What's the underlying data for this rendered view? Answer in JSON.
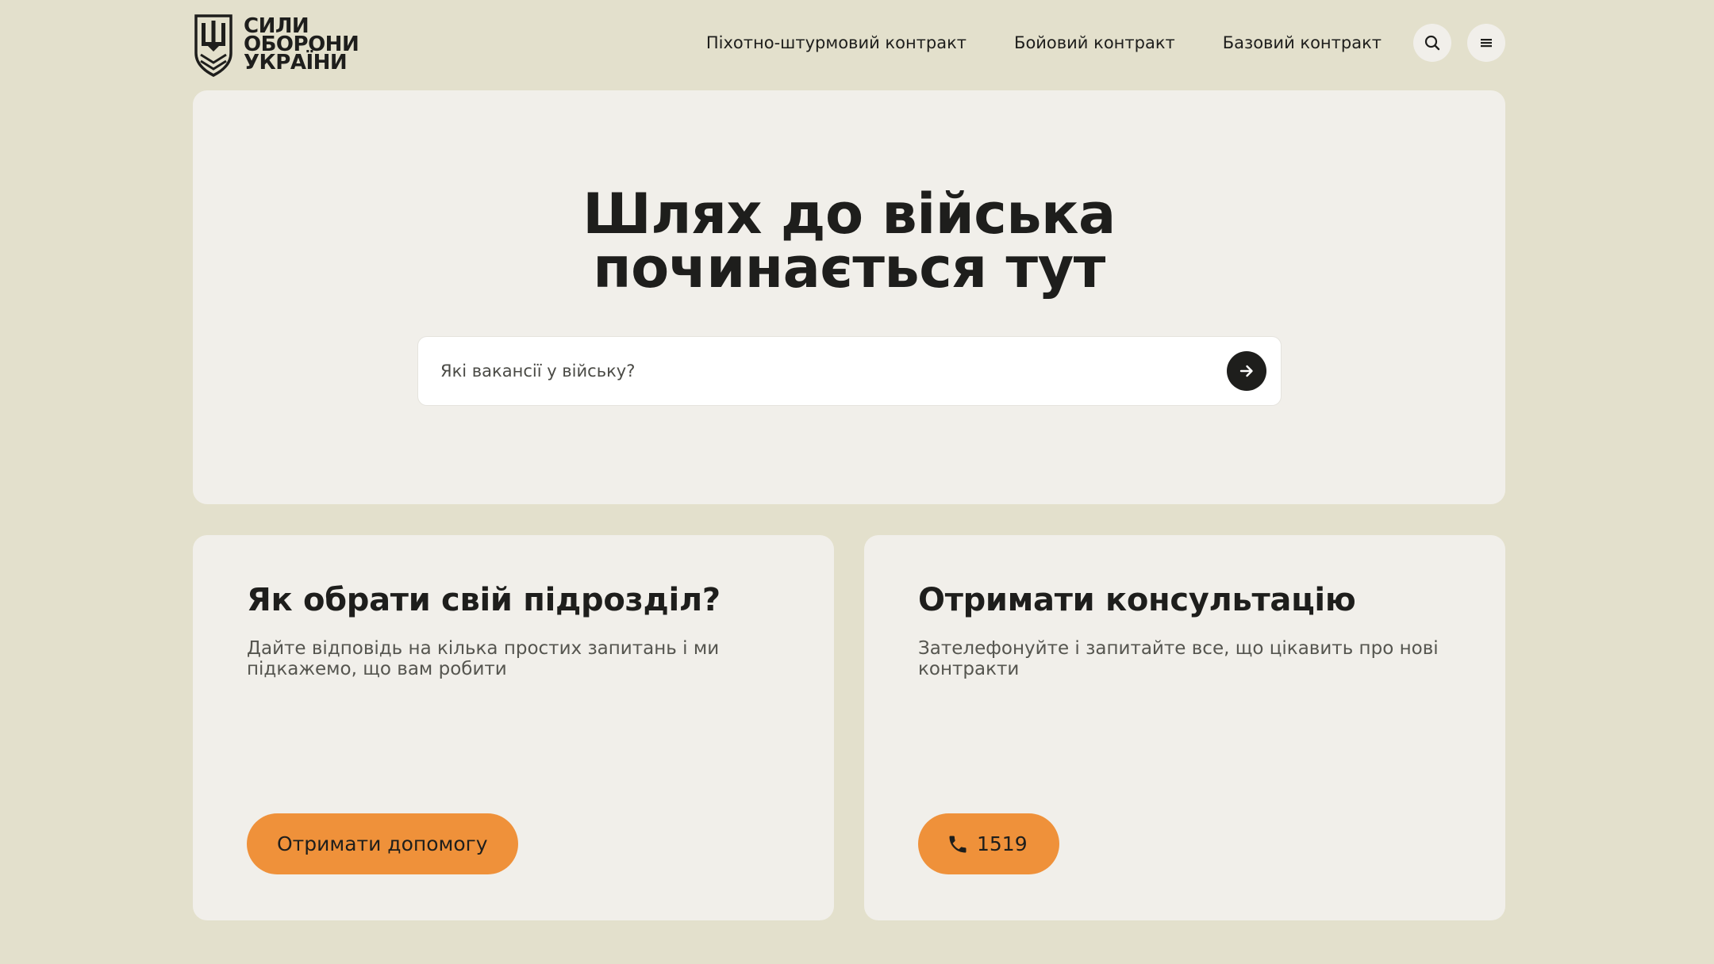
{
  "header": {
    "logo": {
      "line1": "Сили",
      "line2": "Оборони",
      "line3": "України"
    },
    "nav": [
      {
        "label": "Піхотно-штурмовий контракт"
      },
      {
        "label": "Бойовий контракт"
      },
      {
        "label": "Базовий контракт"
      }
    ],
    "search_icon": "search-icon",
    "menu_icon": "hamburger-menu-icon"
  },
  "hero": {
    "title_line1": "Шлях до війська",
    "title_line2": "починається тут",
    "search": {
      "placeholder": "Які вакансії у війську?",
      "submit_icon": "arrow-right-icon"
    }
  },
  "cards": [
    {
      "title": "Як обрати свій підрозділ?",
      "description": "Дайте відповідь на кілька простих запитань і ми підкажемо, що вам робити",
      "button_label": "Отримати допомогу"
    },
    {
      "title": "Отримати консультацію",
      "description": "Зателефонуйте і запитайте все, що цікавить про нові контракти",
      "button_label": "1519",
      "button_icon": "phone-icon"
    }
  ],
  "colors": {
    "page_background": "#e3e0cc",
    "card_background": "#f1efea",
    "accent_orange": "#ef913a",
    "text_dark": "#1e1e1c"
  }
}
